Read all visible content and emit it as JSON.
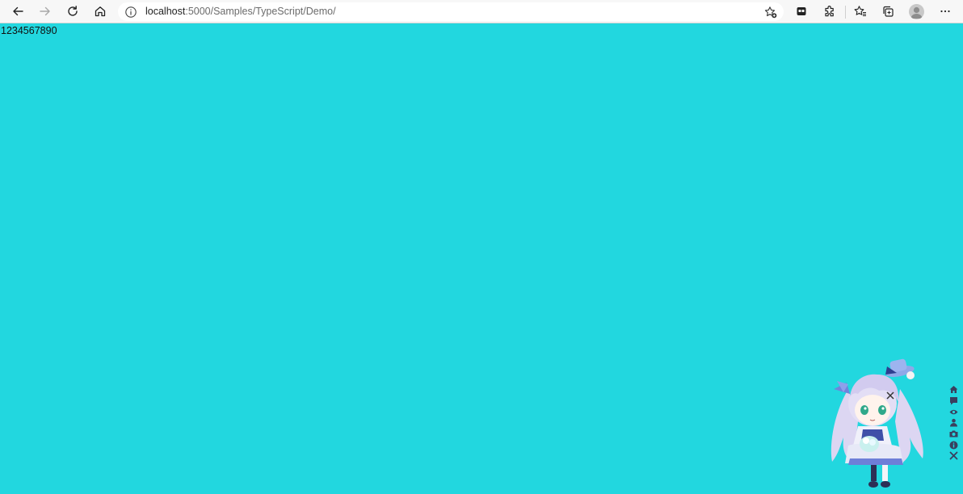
{
  "browser": {
    "url_host": "localhost",
    "url_path": ":5000/Samples/TypeScript/Demo/",
    "toolbar_icons": [
      "back-arrow-icon",
      "forward-arrow-icon",
      "refresh-icon",
      "home-icon",
      "info-icon",
      "add-favorite-icon",
      "game-controller-icon",
      "extensions-puzzle-icon",
      "favorites-star-icon",
      "collections-icon",
      "profile-avatar-icon",
      "more-dots-icon"
    ]
  },
  "page": {
    "background": "#22d7df",
    "counter_text": "1234567890"
  },
  "widget": {
    "tools": [
      "home-icon",
      "comment-icon",
      "eye-icon",
      "user-icon",
      "camera-icon",
      "info-icon",
      "close-icon"
    ]
  }
}
